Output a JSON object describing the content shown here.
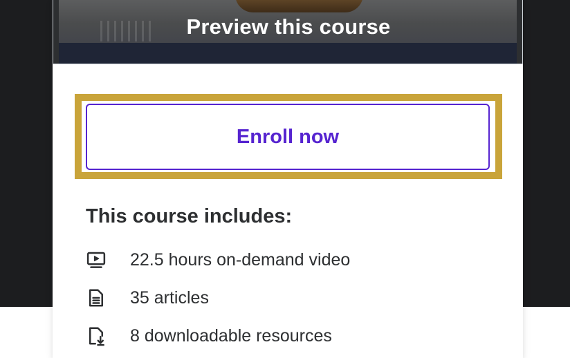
{
  "preview": {
    "label": "Preview this course"
  },
  "enroll": {
    "label": "Enroll now"
  },
  "includes": {
    "title": "This course includes:",
    "items": [
      {
        "icon": "video-icon",
        "label": "22.5 hours on-demand video"
      },
      {
        "icon": "article-icon",
        "label": "35 articles"
      },
      {
        "icon": "download-file-icon",
        "label": "8 downloadable resources"
      }
    ]
  },
  "colors": {
    "accent": "#5624d0",
    "highlight": "#c9a43a",
    "text": "#2d2f31",
    "background_dark": "#1c1d1f"
  }
}
